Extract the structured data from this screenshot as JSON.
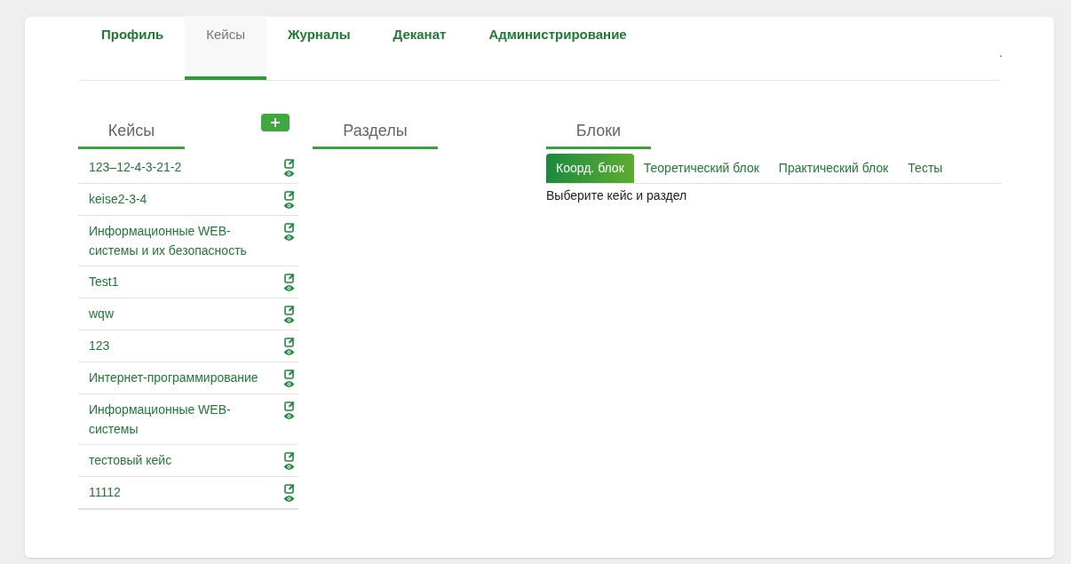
{
  "nav": {
    "tabs": [
      {
        "label": "Профиль",
        "selected": false
      },
      {
        "label": "Кейсы",
        "selected": true
      },
      {
        "label": "Журналы",
        "selected": false
      },
      {
        "label": "Деканат",
        "selected": false
      },
      {
        "label": "Администрирование",
        "selected": false
      }
    ],
    "corner_text": "."
  },
  "cases": {
    "title": "Кейсы",
    "items": [
      {
        "name": "123–12-4-3-21-2"
      },
      {
        "name": "keise2-3-4"
      },
      {
        "name": "Информационные WEB-системы и их безопасность"
      },
      {
        "name": "Test1"
      },
      {
        "name": "wqw"
      },
      {
        "name": "123"
      },
      {
        "name": "Интернет-программирование"
      },
      {
        "name": "Информационные WEB-системы"
      },
      {
        "name": "тестовый кейс"
      },
      {
        "name": "11112"
      }
    ]
  },
  "sections": {
    "title": "Разделы"
  },
  "blocks": {
    "title": "Блоки",
    "tabs": [
      {
        "label": "Коорд. блок",
        "selected": true
      },
      {
        "label": "Теоретический блок",
        "selected": false
      },
      {
        "label": "Практический блок",
        "selected": false
      },
      {
        "label": "Тесты",
        "selected": false
      }
    ],
    "message": "Выберите кейс и раздел"
  }
}
